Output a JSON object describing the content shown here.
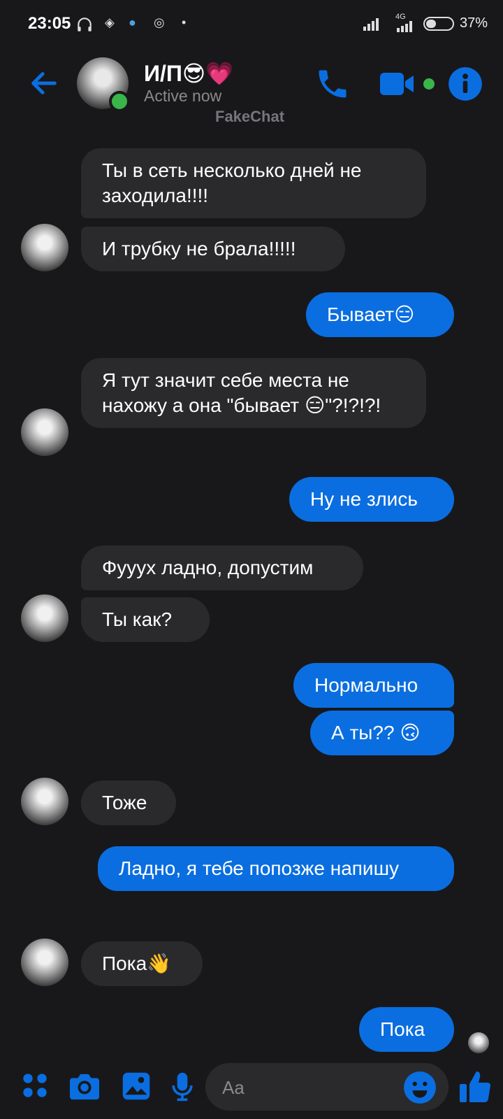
{
  "status_bar": {
    "time": "23:05",
    "network": "4G",
    "battery": "37%",
    "icons": [
      "headphones-icon",
      "app-icon",
      "telegram-icon",
      "app-icon",
      "dot-icon",
      "signal-icon",
      "signal-4g-icon",
      "battery-icon"
    ]
  },
  "header": {
    "name": "И/П😎💗",
    "status": "Active now",
    "watermark": "FakeChat",
    "accent": "#0a6ee0",
    "online_color": "#3ab54a"
  },
  "messages": [
    {
      "side": "in",
      "text": "Ты в сеть несколько дней не заходила!!!!"
    },
    {
      "side": "in",
      "text": "И трубку не брала!!!!!"
    },
    {
      "side": "out",
      "text": "Бывает😑"
    },
    {
      "side": "in",
      "text": "Я тут значит себе места не нахожу а она \"бывает 😑\"?!?!?!"
    },
    {
      "side": "out",
      "text": "Ну не злись"
    },
    {
      "side": "in",
      "text": "Фууух ладно, допустим"
    },
    {
      "side": "in",
      "text": "Ты как?"
    },
    {
      "side": "out",
      "text": "Нормально"
    },
    {
      "side": "out",
      "text": "А ты?? 🙃"
    },
    {
      "side": "in",
      "text": "Тоже"
    },
    {
      "side": "out",
      "text": "Ладно, я тебе попозже напишу"
    },
    {
      "side": "in",
      "text": "Пока👋"
    },
    {
      "side": "out",
      "text": "Пока"
    }
  ],
  "composer": {
    "placeholder": "Aa",
    "icons": [
      "menu-dots-icon",
      "camera-icon",
      "gallery-icon",
      "microphone-icon",
      "emoji-icon",
      "like-icon"
    ]
  }
}
